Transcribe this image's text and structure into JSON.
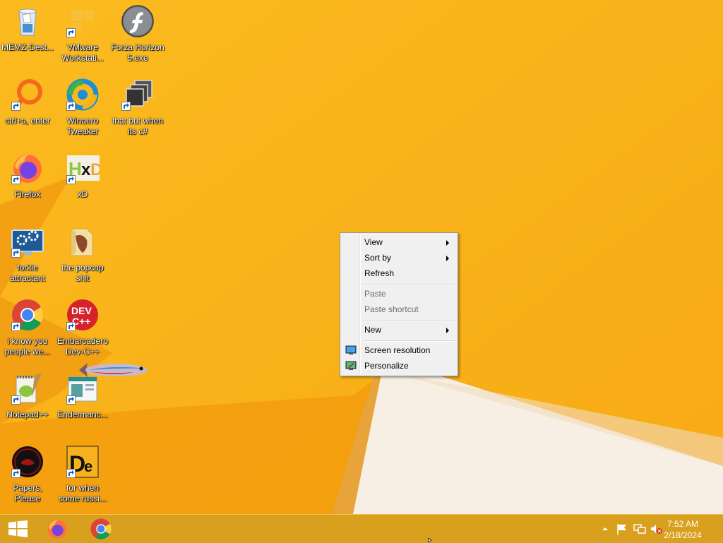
{
  "desktop": {
    "icons": [
      {
        "label": "MEMZ-Dest...",
        "icon": "recycle-bin-icon"
      },
      {
        "label": "VMware Workstati...",
        "icon": "vmware-icon"
      },
      {
        "label": "Forza Horizon 5.exe",
        "icon": "flash-icon"
      },
      {
        "label": "ctrl+a, enter",
        "icon": "orange-ring-icon"
      },
      {
        "label": "Winaero Tweaker",
        "icon": "winaero-icon"
      },
      {
        "label": "that but when its c#",
        "icon": "stacked-windows-icon"
      },
      {
        "label": "Firefox",
        "icon": "firefox-icon"
      },
      {
        "label": "xD",
        "icon": "hxd-icon"
      },
      {
        "label": "forkie attractant",
        "icon": "monitor-gear-icon"
      },
      {
        "label": "the popcap shit",
        "icon": "folder-icon"
      },
      {
        "label": "i know you people we...",
        "icon": "chrome-icon"
      },
      {
        "label": "Embarcadero Dev-C++",
        "icon": "devcpp-icon"
      },
      {
        "label": "Notepad++",
        "icon": "notepadpp-icon"
      },
      {
        "label": "Endermanc...",
        "icon": "window-app-icon"
      },
      {
        "label": "Papers, Please",
        "icon": "papers-please-icon"
      },
      {
        "label": "for when some russi...",
        "icon": "de-icon"
      }
    ]
  },
  "context_menu": {
    "items": [
      {
        "label": "View",
        "submenu": true,
        "enabled": true
      },
      {
        "label": "Sort by",
        "submenu": true,
        "enabled": true
      },
      {
        "label": "Refresh",
        "enabled": true
      },
      {
        "label": "Paste",
        "enabled": false
      },
      {
        "label": "Paste shortcut",
        "enabled": false
      },
      {
        "label": "New",
        "submenu": true,
        "enabled": true
      },
      {
        "label": "Screen resolution",
        "enabled": true,
        "icon": "display-icon"
      },
      {
        "label": "Personalize",
        "enabled": true,
        "icon": "personalize-icon"
      }
    ]
  },
  "taskbar": {
    "pinned": [
      "start-icon",
      "firefox-icon",
      "chrome-icon"
    ],
    "tray_icons": [
      "show-hidden-icons-chevron",
      "action-center-flag-icon",
      "network-icon",
      "volume-muted-icon"
    ],
    "clock": {
      "time": "7:52 AM",
      "date": "2/18/2024"
    }
  },
  "colors": {
    "wallpaper": "#f8b21a",
    "taskbar": "#d69e20",
    "menu_bg": "#f0f0f0"
  }
}
